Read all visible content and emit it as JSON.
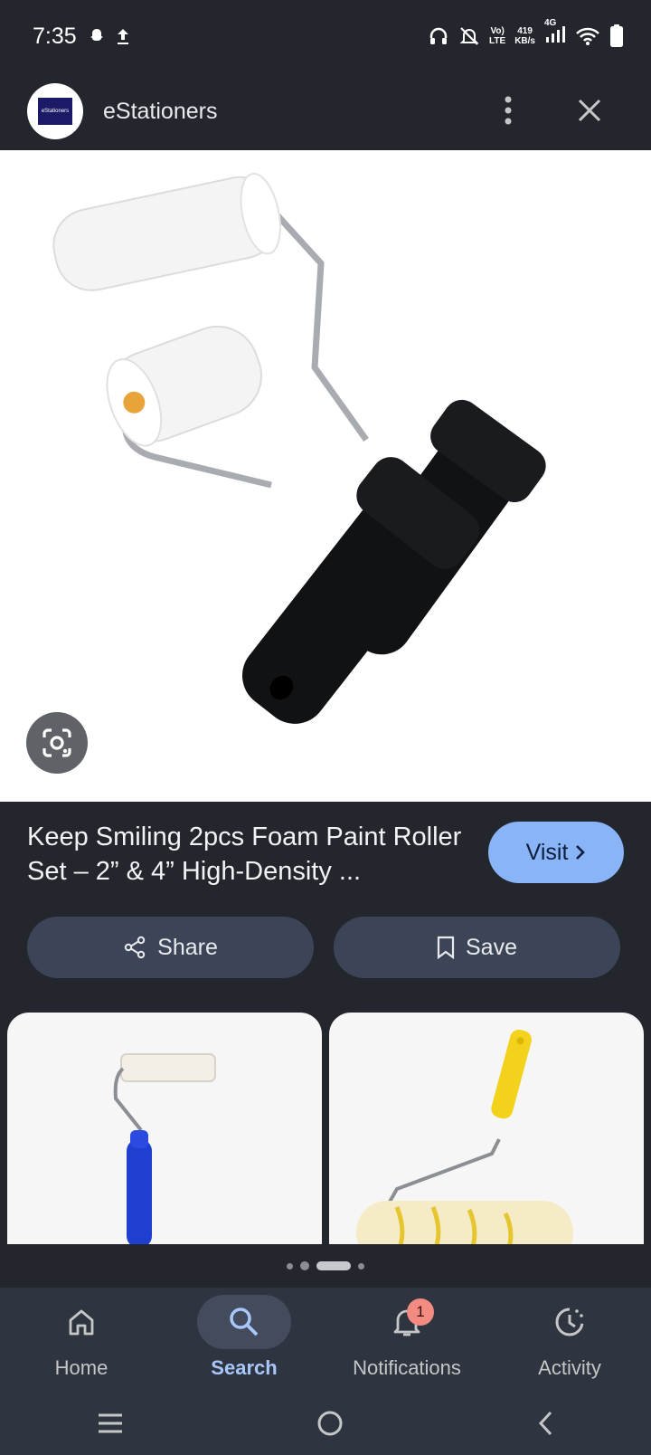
{
  "status_bar": {
    "time": "7:35",
    "net_top": "Vo)",
    "net_bottom": "LTE",
    "speed_top": "419",
    "speed_bottom": "KB/s",
    "signal_label": "4G"
  },
  "header": {
    "site_name": "eStationers",
    "logo_text": "eStationers"
  },
  "product": {
    "title": "Keep Smiling 2pcs Foam Paint Roller Set – 2” & 4” High-Density ...",
    "visit_label": "Visit"
  },
  "actions": {
    "share_label": "Share",
    "save_label": "Save"
  },
  "pagination": {
    "current": 3,
    "total": 4
  },
  "bottom_nav": {
    "items": [
      {
        "label": "Home",
        "icon": "home-icon"
      },
      {
        "label": "Search",
        "icon": "search-icon",
        "active": true
      },
      {
        "label": "Notifications",
        "icon": "bell-icon",
        "badge": "1"
      },
      {
        "label": "Activity",
        "icon": "activity-icon"
      }
    ]
  },
  "colors": {
    "background": "#23262d",
    "accent": "#8ab4f8",
    "pill": "#3c4557",
    "badge": "#f28b82"
  }
}
